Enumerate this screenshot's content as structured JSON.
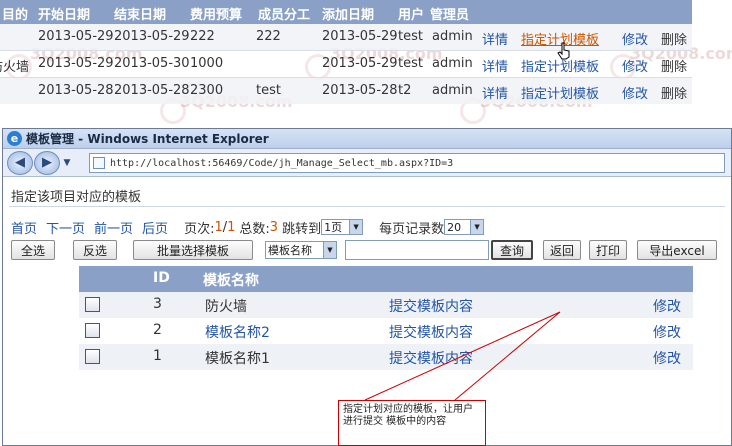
{
  "watermark": "3Q2008.com",
  "top_table": {
    "headers": [
      "目的",
      "开始日期",
      "结束日期",
      "费用预算",
      "成员分工",
      "添加日期",
      "用户",
      "管理员"
    ],
    "rows": [
      {
        "purpose": "",
        "start": "2013-05-29",
        "end": "2013-05-29",
        "budget": "222",
        "division": "222",
        "added": "2013-05-29",
        "user": "test",
        "admin": "admin"
      },
      {
        "purpose": "防火墙",
        "start": "2013-05-29",
        "end": "2013-05-30",
        "budget": "1000",
        "division": "",
        "added": "2013-05-29",
        "user": "test",
        "admin": "admin"
      },
      {
        "purpose": "",
        "start": "2013-05-28",
        "end": "2013-05-28",
        "budget": "2300",
        "division": "test",
        "added": "2013-05-28",
        "user": "t2",
        "admin": "admin"
      }
    ],
    "actions": {
      "detail": "详情",
      "assign": "指定计划模板",
      "edit": "修改",
      "delete": "删除"
    }
  },
  "browser": {
    "title": "模板管理 - Windows Internet Explorer",
    "url": "http://localhost:56469/Code/jh_Manage_Select_mb.aspx?ID=3"
  },
  "content": {
    "page_title": "指定该项目对应的模板",
    "pager": {
      "first": "首页",
      "next": "下一页",
      "prev": "前一页",
      "last": "后页",
      "page_label": "页次:",
      "page_current": "1",
      "page_sep": "/",
      "page_total": "1",
      "total_label": "总数:",
      "total_count": "3",
      "jump_label": "跳转到",
      "jump_value": "1页",
      "per_page_label": "每页记录数",
      "per_page_value": "20"
    },
    "toolbar": {
      "select_all": "全选",
      "invert": "反选",
      "batch_select": "批量选择模板",
      "field_select": "模板名称",
      "search_value": "",
      "query": "查询",
      "back": "返回",
      "print": "打印",
      "export": "导出excel"
    },
    "grid": {
      "headers": {
        "id": "ID",
        "name": "模板名称"
      },
      "rows": [
        {
          "id": "3",
          "name": "防火墙",
          "submit": "提交模板内容",
          "edit": "修改"
        },
        {
          "id": "2",
          "name": "模板名称2",
          "submit": "提交模板内容",
          "edit": "修改"
        },
        {
          "id": "1",
          "name": "模板名称1",
          "submit": "提交模板内容",
          "edit": "修改"
        }
      ]
    }
  },
  "callout": "指定计划对应的模板，让用户进行提交 模板中的内容",
  "colors": {
    "header_bg": "#8aa0c6",
    "link": "#2255aa",
    "active_link": "#cc5500",
    "callout_border": "#cc0000"
  }
}
